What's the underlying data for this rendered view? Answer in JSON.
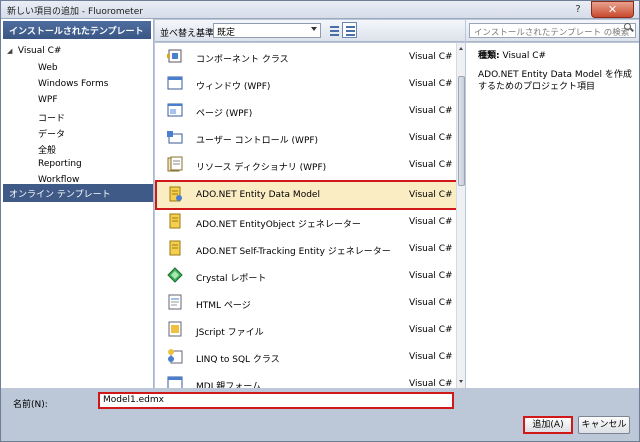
{
  "window": {
    "title": "新しい項目の追加 - Fluorometer",
    "help_glyph": "?",
    "close_glyph": "✕"
  },
  "left": {
    "header": "インストールされたテンプレート",
    "root": "Visual C#",
    "items": [
      "Web",
      "Windows Forms",
      "WPF",
      "コード",
      "データ",
      "全般",
      "Reporting",
      "Workflow"
    ],
    "online": "オンライン テンプレート"
  },
  "toolbar": {
    "sort_label": "並べ替え基準:",
    "sort_value": "既定"
  },
  "templates": [
    {
      "name": "コンポーネント クラス",
      "lang": "Visual C#"
    },
    {
      "name": "ウィンドウ (WPF)",
      "lang": "Visual C#"
    },
    {
      "name": "ページ (WPF)",
      "lang": "Visual C#"
    },
    {
      "name": "ユーザー コントロール (WPF)",
      "lang": "Visual C#"
    },
    {
      "name": "リソース ディクショナリ (WPF)",
      "lang": "Visual C#"
    },
    {
      "name": "ADO.NET Entity Data Model",
      "lang": "Visual C#"
    },
    {
      "name": "ADO.NET EntityObject ジェネレーター",
      "lang": "Visual C#"
    },
    {
      "name": "ADO.NET Self-Tracking Entity ジェネレーター",
      "lang": "Visual C#"
    },
    {
      "name": "Crystal レポート",
      "lang": "Visual C#"
    },
    {
      "name": "HTML ページ",
      "lang": "Visual C#"
    },
    {
      "name": "JScript ファイル",
      "lang": "Visual C#"
    },
    {
      "name": "LINQ to SQL クラス",
      "lang": "Visual C#"
    },
    {
      "name": "MDI 親フォーム",
      "lang": "Visual C#"
    }
  ],
  "search": {
    "placeholder": "インストールされたテンプレート の検索"
  },
  "details": {
    "type_label": "種類:",
    "type_value": "Visual C#",
    "description": "ADO.NET Entity Data Model を作成するためのプロジェクト項目"
  },
  "bottom": {
    "name_label": "名前(N):",
    "name_value": "Model1.edmx",
    "add_label": "追加(A)",
    "cancel_label": "キャンセル"
  },
  "colors": {
    "accent": "#3a5685",
    "selection": "#fbedc3",
    "highlight": "#d01818"
  }
}
